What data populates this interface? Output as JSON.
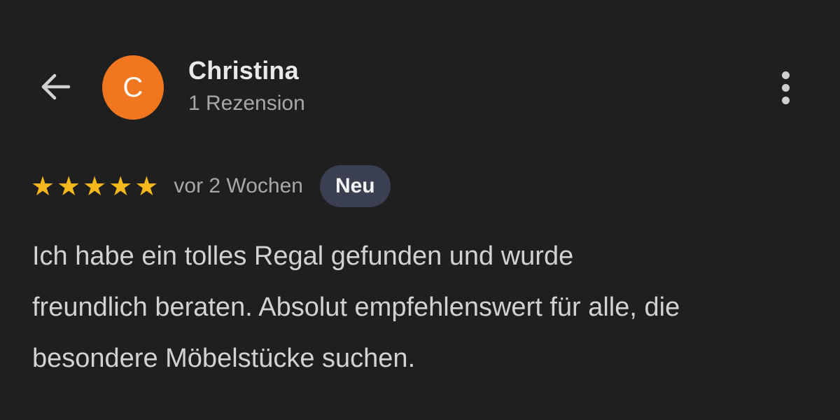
{
  "header": {
    "back_icon": "arrow-left-icon",
    "avatar_letter": "C",
    "avatar_color": "#f0761f",
    "name": "Christina",
    "review_count": "1 Rezension",
    "more_icon": "more-vert-icon"
  },
  "review": {
    "rating": 5,
    "rating_max": 5,
    "star_color": "#f5b81c",
    "time_ago": "vor 2 Wochen",
    "badge": "Neu",
    "text_lines": [
      "Ich habe ein tolles Regal gefunden und wurde",
      "freundlich beraten. Absolut empfehlenswert für alle, die",
      "besondere Möbelstücke suchen."
    ]
  }
}
